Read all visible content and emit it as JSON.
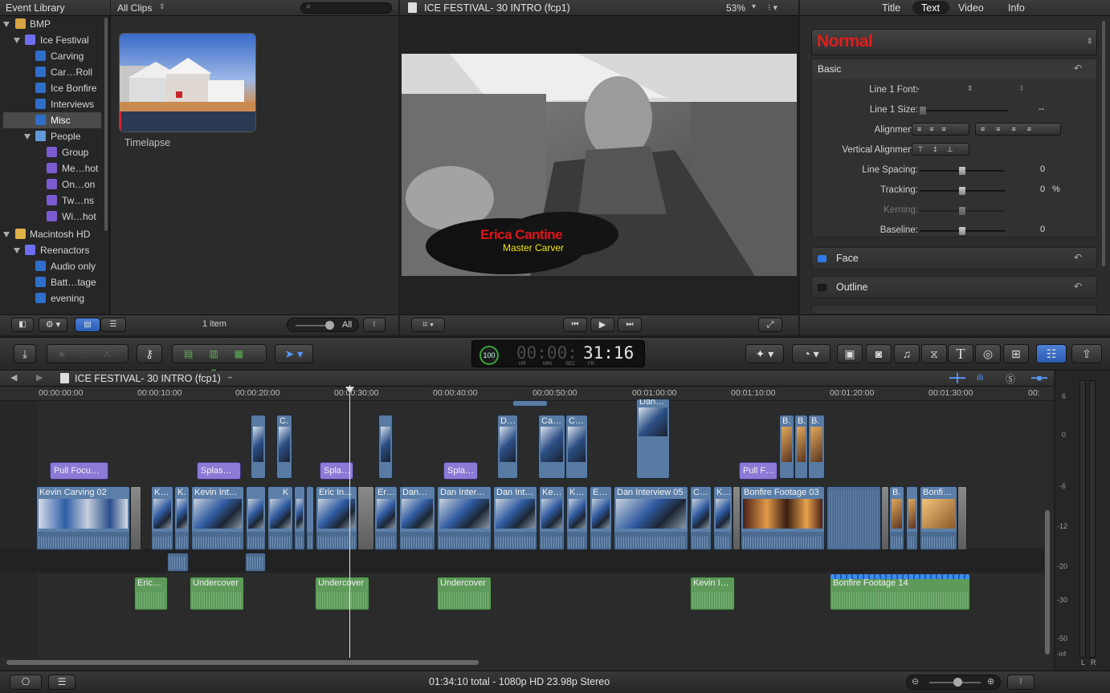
{
  "library": {
    "title": "Event Library",
    "items": [
      {
        "label": "BMP"
      },
      {
        "label": "Ice Festival"
      },
      {
        "label": "Carving"
      },
      {
        "label": "Car…Roll"
      },
      {
        "label": "Ice Bonfire"
      },
      {
        "label": "Interviews"
      },
      {
        "label": "Misc"
      },
      {
        "label": "People"
      },
      {
        "label": "Group"
      },
      {
        "label": "Me…hot"
      },
      {
        "label": "On…on"
      },
      {
        "label": "Tw…ns"
      },
      {
        "label": "Wi…hot"
      },
      {
        "label": "Macintosh HD"
      },
      {
        "label": "Reenactors"
      },
      {
        "label": "Audio only"
      },
      {
        "label": "Batt…tage"
      },
      {
        "label": "evening"
      }
    ],
    "count": "1 item",
    "filter_all": "All"
  },
  "browser": {
    "filter": "All Clips",
    "search_placeholder": "",
    "clip_name": "Timelapse"
  },
  "viewer": {
    "title": "ICE FESTIVAL- 30 INTRO (fcp1)",
    "zoom": "53%",
    "lower_third_name": "Erica Cantine",
    "lower_third_role": "Master Carver"
  },
  "inspector": {
    "tabs": [
      "Title",
      "Text",
      "Video",
      "Info"
    ],
    "active_tab": "Text",
    "preset": "Normal",
    "section_basic": "Basic",
    "rows": [
      {
        "label": "Line 1 Font:",
        "value": "-"
      },
      {
        "label": "Line 1 Size:",
        "value": "--"
      },
      {
        "label": "Alignment:",
        "value": ""
      },
      {
        "label": "Vertical Alignment:",
        "value": ""
      },
      {
        "label": "Line Spacing:",
        "value": "0"
      },
      {
        "label": "Tracking:",
        "value": "0",
        "unit": "%"
      },
      {
        "label": "Kerning:",
        "value": ""
      },
      {
        "label": "Baseline:",
        "value": "0"
      }
    ],
    "section_face": "Face",
    "section_outline": "Outline"
  },
  "timecode": {
    "percent": "100",
    "value": "31:16",
    "units": [
      "HR",
      "MIN",
      "SEC",
      "FR"
    ]
  },
  "timeline": {
    "project": "ICE FESTIVAL- 30 INTRO (fcp1)",
    "ruler": [
      "00:00:00:00",
      "00:00:10:00",
      "00:00:20:00",
      "00:00:30:00",
      "00:00:40:00",
      "00:00:50:00",
      "00:01:00:00",
      "00:01:10:00",
      "00:01:20:00",
      "00:01:30:00",
      "00:"
    ],
    "primary": [
      "Kevin Carving 02",
      "K…",
      "K.",
      "Kevin Int…",
      "K",
      "Eric In…",
      "Er…",
      "Dan…",
      "Dan Inter…",
      "Dan Int…",
      "Ke…",
      "K…",
      "E…",
      "Dan Interview 05",
      "C…",
      "K…",
      "Bonfire Footage 03",
      "B.",
      "Bonfi…"
    ],
    "titles": [
      "Pull Focu…",
      "Splas…",
      "Spla…",
      "Spla…",
      "Pull F…"
    ],
    "connected": [
      "C.",
      "D…",
      "Ca…",
      "C…",
      "Dan…",
      "B.",
      "B.",
      "B."
    ],
    "audio": [
      "Eric…",
      "Undercover",
      "Undercover",
      "Undercover",
      "Kevin I…",
      "Bonfire Footage 14"
    ]
  },
  "meter": {
    "scale": [
      "6",
      "0",
      "-6",
      "-12",
      "-20",
      "-30",
      "-50",
      "-inf"
    ],
    "channels": [
      "L",
      "R"
    ]
  },
  "status": {
    "summary": "01:34:10 total - 1080p HD 23.98p Stereo"
  }
}
